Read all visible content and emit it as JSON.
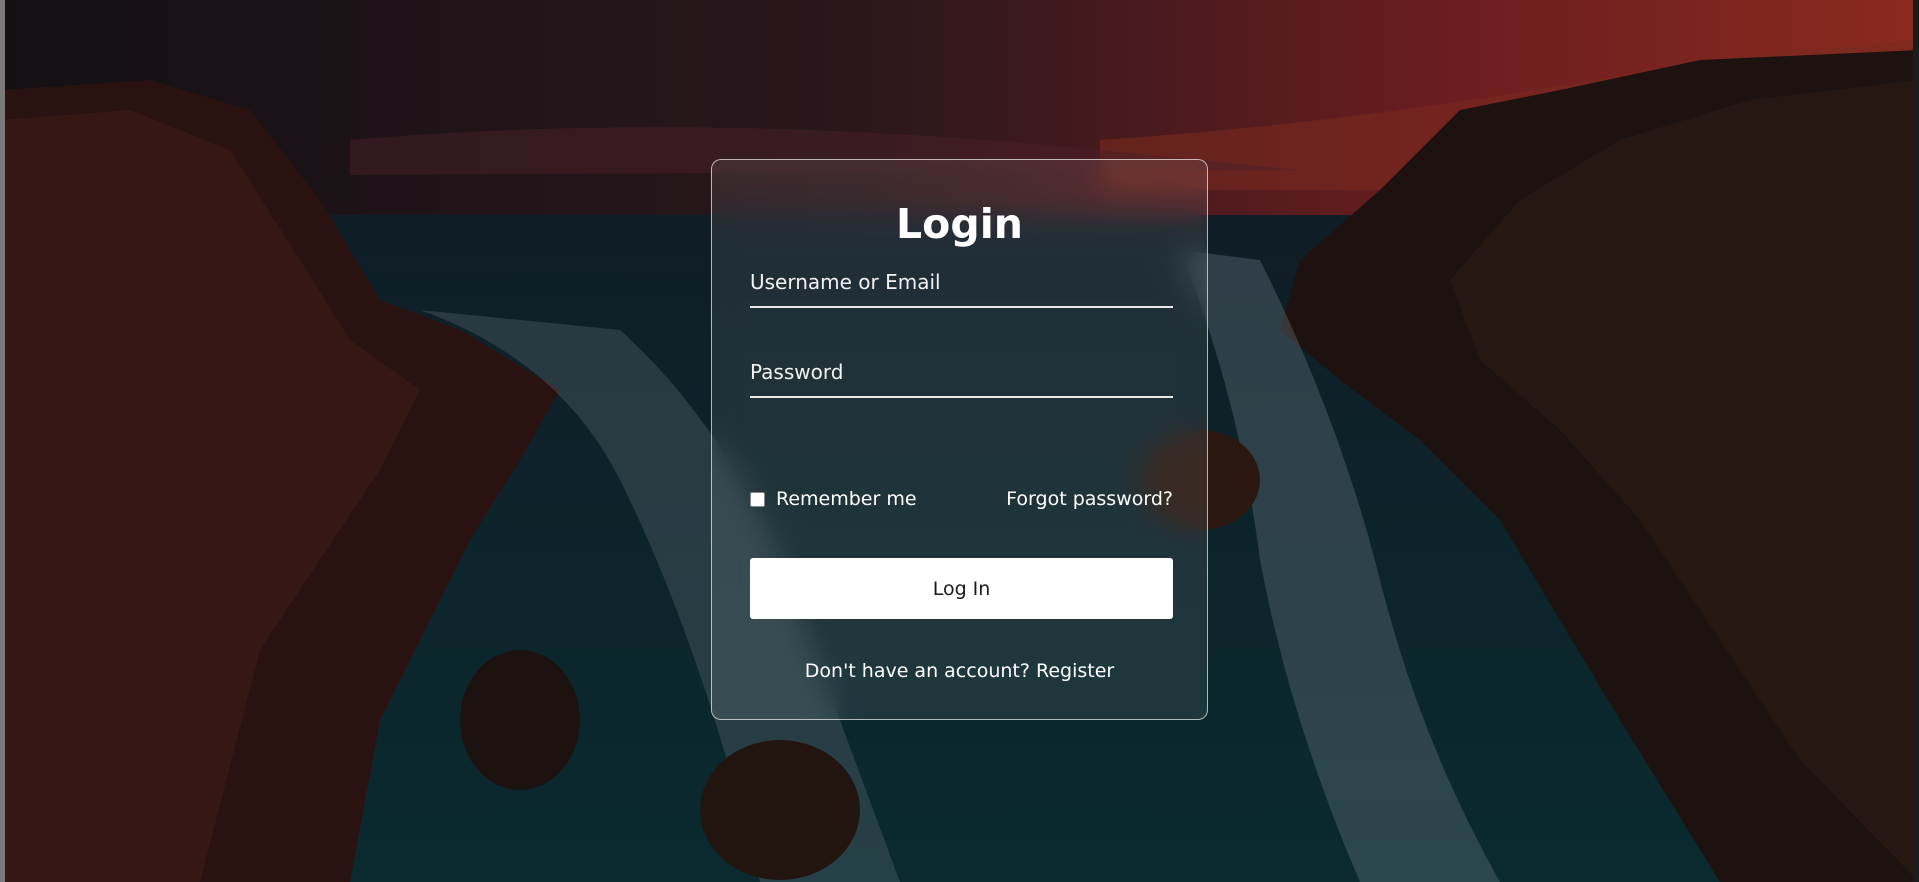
{
  "login_card": {
    "title": "Login",
    "username_placeholder": "Username or Email",
    "password_placeholder": "Password",
    "remember_label": "Remember me",
    "forgot_label": "Forgot password?",
    "submit_label": "Log In",
    "register_prompt": "Don't have an account?",
    "register_link": "Register"
  },
  "colors": {
    "card_border": "#e6e6e6",
    "button_bg": "#ffffff",
    "text": "#ffffff"
  }
}
